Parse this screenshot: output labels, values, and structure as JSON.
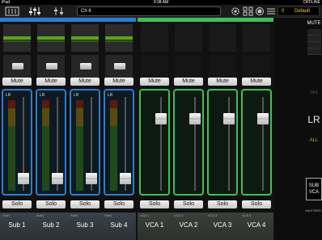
{
  "status": {
    "device": "iPad",
    "time": "9:38 AM",
    "battery": "OFFLINE"
  },
  "toolbar": {
    "channel_name": "Ch 6",
    "scene_number": "0",
    "scene_name": "Default"
  },
  "strips": [
    {
      "kind": "sub",
      "name": "Sub 1",
      "tag": "Sub1",
      "meter_label": "LR",
      "mute": "Mute",
      "solo": "Solo",
      "fader_level": 0.08
    },
    {
      "kind": "sub",
      "name": "Sub 2",
      "tag": "Sub2",
      "meter_label": "LR",
      "mute": "Mute",
      "solo": "Solo",
      "fader_level": 0.08
    },
    {
      "kind": "sub",
      "name": "Sub 3",
      "tag": "Sub3",
      "meter_label": "LR",
      "mute": "Mute",
      "solo": "Solo",
      "fader_level": 0.08
    },
    {
      "kind": "sub",
      "name": "Sub 4",
      "tag": "Sub4",
      "meter_label": "LR",
      "mute": "Mute",
      "solo": "Solo",
      "fader_level": 0.08
    },
    {
      "kind": "vca",
      "name": "VCA 1",
      "tag": "VCA 1",
      "meter_label": "",
      "mute": "Mute",
      "solo": "Solo",
      "fader_level": 0.8
    },
    {
      "kind": "vca",
      "name": "VCA 2",
      "tag": "VCA 2",
      "meter_label": "",
      "mute": "Mute",
      "solo": "Solo",
      "fader_level": 0.8
    },
    {
      "kind": "vca",
      "name": "VCA 3",
      "tag": "VCA 3",
      "meter_label": "",
      "mute": "Mute",
      "solo": "Solo",
      "fader_level": 0.8
    },
    {
      "kind": "vca",
      "name": "VCA 4",
      "tag": "VCA 4",
      "meter_label": "",
      "mute": "Mute",
      "solo": "Solo",
      "fader_level": 0.8
    }
  ],
  "right_panel": {
    "mute_label": "MUTE",
    "mix_label": "MIX",
    "lr_label": "LR",
    "all_label": "ALL",
    "sub_label": "SUB",
    "vca_label": "VCA",
    "master_label": "MASTERS"
  },
  "colors": {
    "sub_accent": "#2d7dd2",
    "vca_accent": "#3fbf5a",
    "scene_text": "#ffd800"
  }
}
